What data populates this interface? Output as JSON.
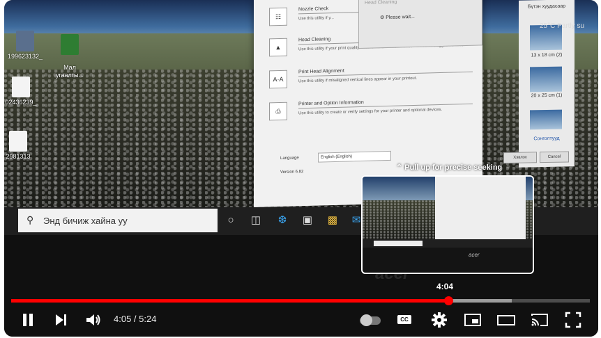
{
  "scene": {
    "desktop_icons": [
      "199623132_",
      "Мал\nугаалгы...",
      "02436239_",
      "2981313"
    ],
    "printer_window": {
      "popup_title": "Head Cleaning",
      "popup_status": "Please wait...",
      "utilities": [
        {
          "icon": "nozzle-check-icon",
          "name": "Nozzle Check",
          "desc": "Use this utility if y..."
        },
        {
          "icon": "head-cleaning-icon",
          "name": "Head Cleaning",
          "desc": "Use this utility if your print quality declines or the Nozzle Check indicates clogged nozzles."
        },
        {
          "icon": "print-head-alignment-icon",
          "glyph": "A·A",
          "name": "Print Head Alignment",
          "desc": "Use this utility if misaligned vertical lines appear in your printout."
        },
        {
          "icon": "printer-option-info-icon",
          "name": "Printer and Option Information",
          "desc": "Use this utility to create or verify settings for your printer and optional devices."
        }
      ],
      "language_label": "Language",
      "language_value": "English (English)",
      "version": "Version 6.82"
    },
    "photo_panel": {
      "top_label": "Бүтэн хуудасаар",
      "sizes": [
        "13 x 18 cm (2)",
        "20 x 25 cm (1)"
      ],
      "link": "Сонголтууд",
      "buttons": [
        "Хэвлэх",
        "Cancel"
      ]
    },
    "taskbar": {
      "search_placeholder": "Энд бичиж хайна уу",
      "weather": "25°C Partly su"
    },
    "laptop_brand": "acer"
  },
  "player": {
    "seek_hint": "Pull up for precise seeking",
    "preview_time": "4:04",
    "current_time": "4:05",
    "duration": "5:24",
    "time_display": "4:05 / 5:24",
    "progress_fraction": 0.756,
    "preview_fraction": 0.753,
    "buffered_fraction": 0.865,
    "cc_label": "CC",
    "colors": {
      "played": "#ff0000",
      "controls": "#ffffff"
    },
    "buttons": [
      "pause-icon",
      "next-icon",
      "volume-icon",
      "autoplay-toggle",
      "subtitles-icon",
      "settings-gear-icon",
      "miniplayer-icon",
      "theater-mode-icon",
      "cast-icon",
      "fullscreen-icon"
    ]
  }
}
